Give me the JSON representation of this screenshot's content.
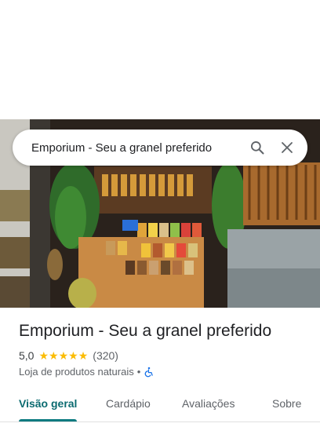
{
  "search": {
    "query": "Emporium - Seu a granel preferido",
    "search_icon": "search-icon",
    "clear_icon": "close-icon"
  },
  "place": {
    "name": "Emporium - Seu a granel preferido",
    "rating": "5,0",
    "stars": 5,
    "review_count": "(320)",
    "category": "Loja de produtos naturais",
    "separator": "•",
    "accessibility_icon": "wheelchair-icon"
  },
  "tabs": [
    {
      "label": "Visão geral",
      "active": true
    },
    {
      "label": "Cardápio",
      "active": false
    },
    {
      "label": "Avaliações",
      "active": false
    },
    {
      "label": "Sobre",
      "active": false
    }
  ],
  "colors": {
    "accent": "#0b7a80",
    "star": "#fbbc04",
    "accessibility": "#1a73e8"
  }
}
